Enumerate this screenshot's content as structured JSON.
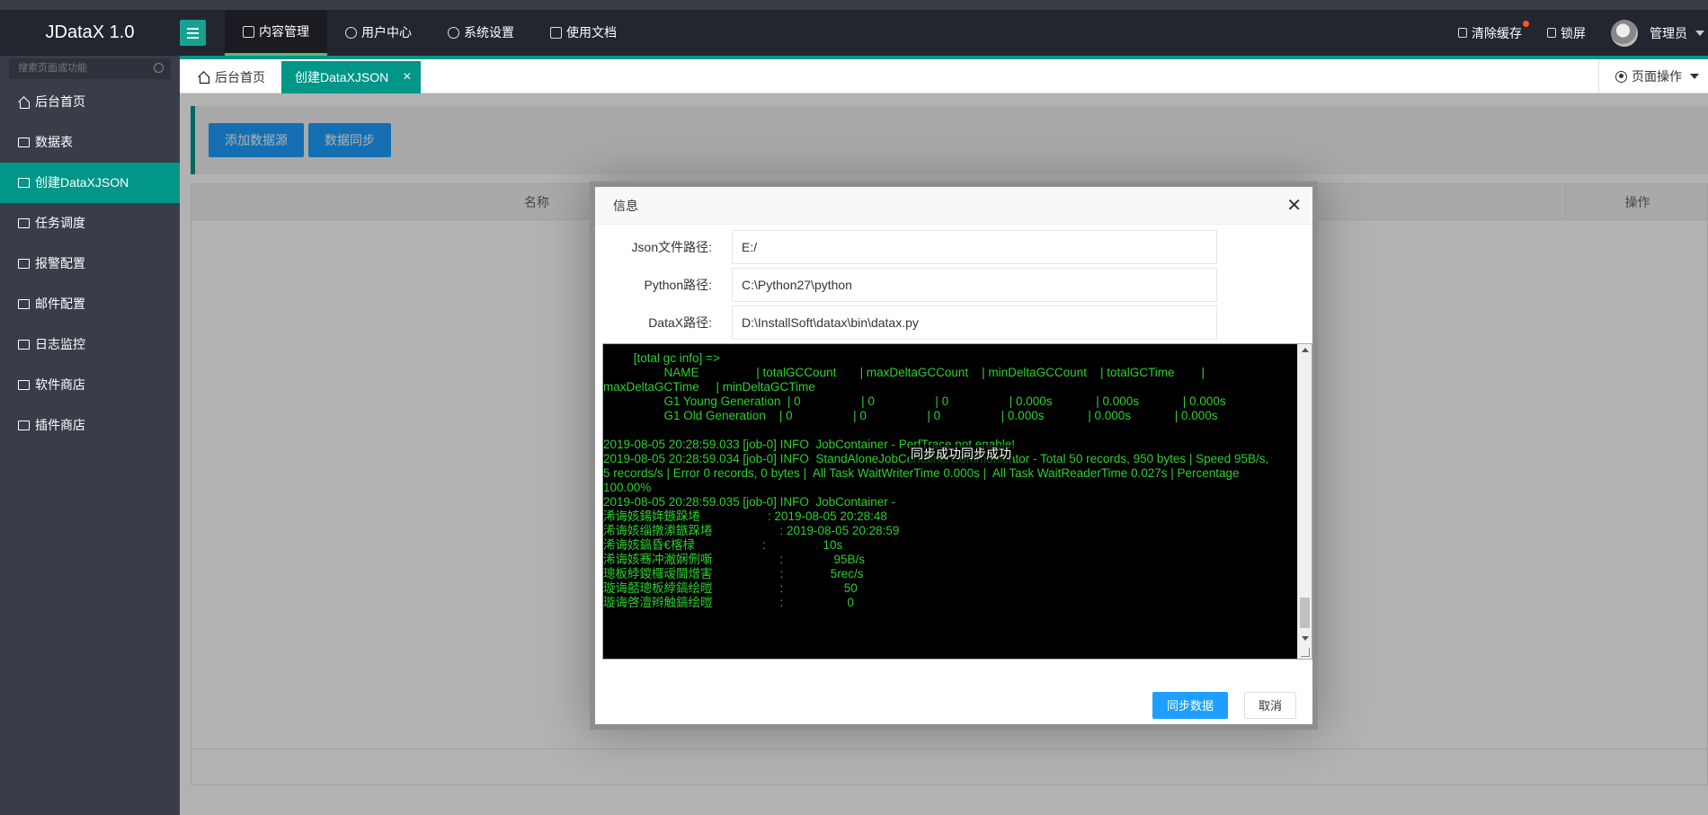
{
  "app": {
    "title": "JDataX 1.0"
  },
  "topnav": [
    {
      "label": "内容管理",
      "icon": "document-icon"
    },
    {
      "label": "用户中心",
      "icon": "users-icon"
    },
    {
      "label": "系统设置",
      "icon": "gear-icon"
    },
    {
      "label": "使用文档",
      "icon": "book-icon"
    }
  ],
  "topright": {
    "clear_cache": "清除缓存",
    "lock": "锁屏",
    "user": "管理员"
  },
  "sidebar": {
    "search_placeholder": "搜索页面或功能",
    "items": [
      {
        "label": "后台首页",
        "icon": "home-icon"
      },
      {
        "label": "数据表",
        "icon": "table-icon"
      },
      {
        "label": "创建DataXJSON",
        "icon": "image-icon",
        "active": true
      },
      {
        "label": "任务调度",
        "icon": "image-icon"
      },
      {
        "label": "报警配置",
        "icon": "image-icon"
      },
      {
        "label": "邮件配置",
        "icon": "image-icon"
      },
      {
        "label": "日志监控",
        "icon": "image-icon"
      },
      {
        "label": "软件商店",
        "icon": "image-icon"
      },
      {
        "label": "插件商店",
        "icon": "image-icon"
      }
    ]
  },
  "tabs": [
    {
      "label": "后台首页"
    },
    {
      "label": "创建DataXJSON",
      "active": true
    }
  ],
  "page_ops": "页面操作",
  "toolbar": {
    "add_datasource": "添加数据源",
    "data_sync": "数据同步"
  },
  "table": {
    "headers": [
      "名称",
      "操作"
    ]
  },
  "dialog": {
    "title": "信息",
    "fields": [
      {
        "label": "Json文件路径:",
        "value": "E:/"
      },
      {
        "label": "Python路径:",
        "value": "C:\\Python27\\python"
      },
      {
        "label": "DataX路径:",
        "value": "D:\\InstallSoft\\datax\\bin\\datax.py"
      }
    ],
    "console": "         [total gc info] =>\n                  NAME                 | totalGCCount       | maxDeltaGCCount    | minDeltaGCCount    | totalGCTime        |\nmaxDeltaGCTime     | minDeltaGCTime\n                  G1 Young Generation  | 0                  | 0                  | 0                  | 0.000s             | 0.000s             | 0.000s\n                  G1 Old Generation    | 0                  | 0                  | 0                  | 0.000s             | 0.000s             | 0.000s\n\n2019-08-05 20:28:59.033 [job-0] INFO  JobContainer - PerfTrace not enable!\n2019-08-05 20:28:59.034 [job-0] INFO  StandAloneJobContainerCommunicator - Total 50 records, 950 bytes | Speed 95B/s,\n5 records/s | Error 0 records, 0 bytes |  All Task WaitWriterTime 0.000s |  All Task WaitReaderTime 0.027s | Percentage\n100.00%\n2019-08-05 20:28:59.035 [job-0] INFO  JobContainer -\n浠诲姟鍚姩鏃跺埢                    : 2019-08-05 20:28:48\n浠诲姟缁撴潫鏃跺埢                    : 2019-08-05 20:28:59\n浠诲姟鎬昏€楁椂                    :                 10s\n浠诲姟骞冲潎娴侀噺                    :               95B/s\n璁板綍鍐欏叆閫熷害                    :              5rec/s\n璇诲嚭璁板綍鎬绘暟                    :                  50\n璇诲啓澶辫触鎬绘暟                    :                   0",
    "toast": "同步成功同步成功",
    "confirm": "同步数据",
    "cancel": "取消"
  },
  "colors": {
    "accent": "#009688",
    "primary": "#1e9fff",
    "topbar": "#23262e",
    "sidebar": "#393d49",
    "console_text": "#2ecf2e"
  }
}
